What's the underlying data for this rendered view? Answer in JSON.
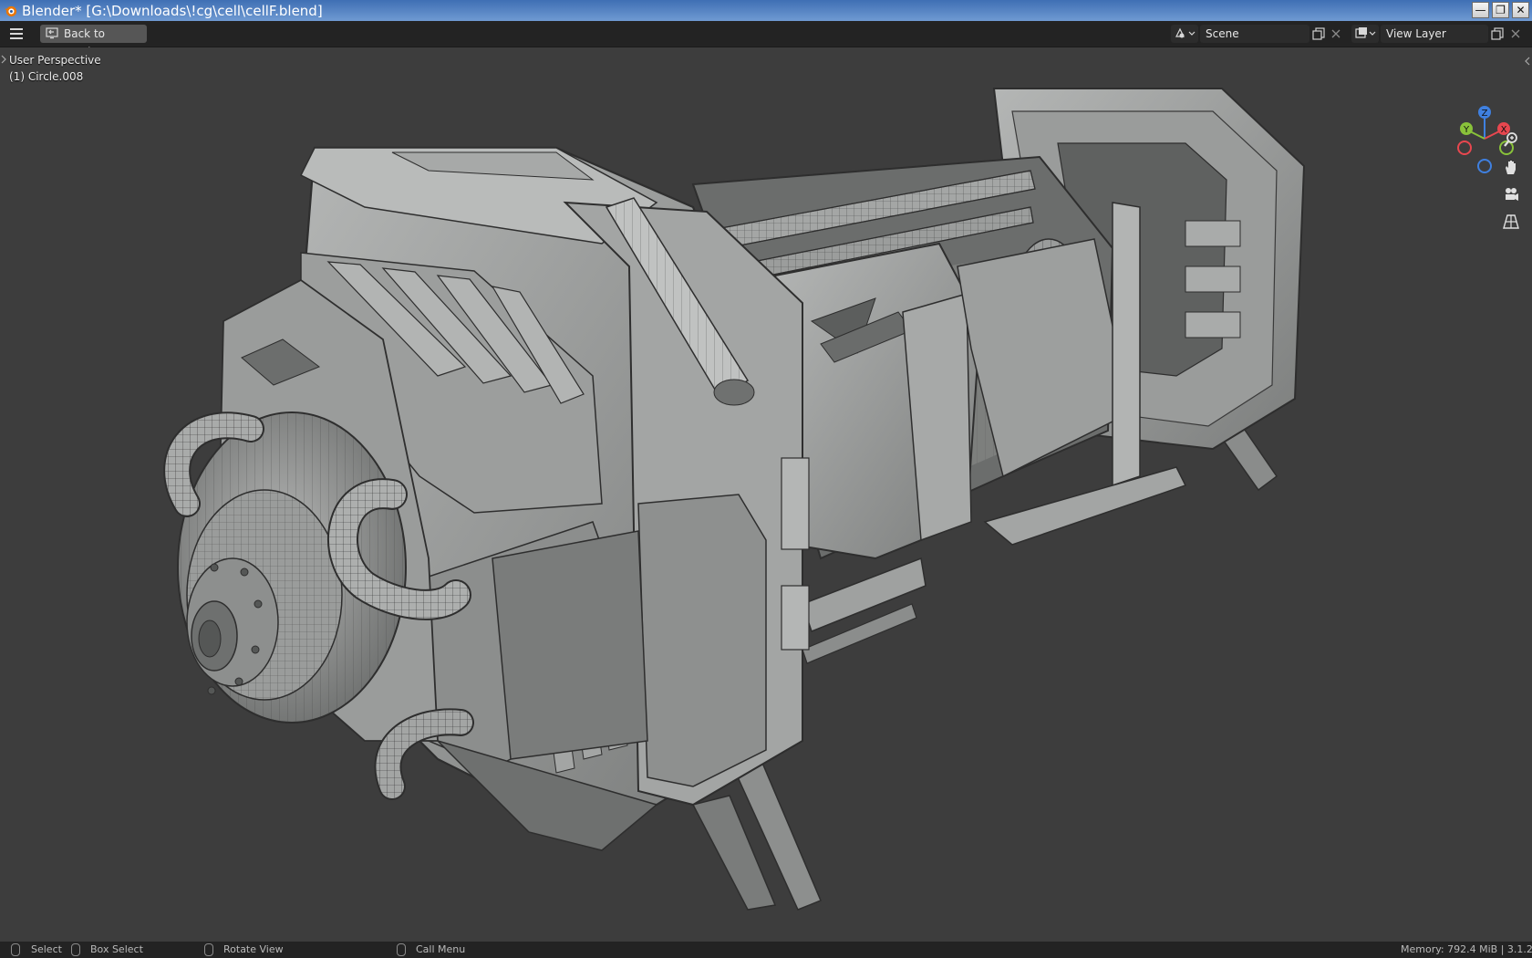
{
  "window": {
    "title": "Blender* [G:\\Downloads\\!cg\\cell\\cellF.blend]",
    "icon": "blender-logo-icon",
    "controls": [
      "minimize-icon",
      "restore-icon",
      "close-icon"
    ]
  },
  "topbar": {
    "menu_icon": "hamburger-menu-icon",
    "back_label": "Back to Previous",
    "scene": {
      "label": "Scene",
      "icon": "scene-icon"
    },
    "view_layer": {
      "label": "View Layer",
      "icon": "view-layer-icon"
    }
  },
  "viewport": {
    "view_name": "User Perspective",
    "object_info": "(1) Circle.008",
    "gizmo_axes": {
      "z": "Z",
      "y": "Y",
      "x": "X"
    },
    "colors": {
      "background": "#3d3d3d",
      "x_axis": "#e8474f",
      "y_axis": "#89c23a",
      "z_axis": "#3f80e0"
    },
    "nav_icons": [
      "zoom-icon",
      "pan-hand-icon",
      "camera-icon",
      "grid-icon"
    ]
  },
  "statusbar": {
    "select": "Select",
    "box_select": "Box Select",
    "rotate_view": "Rotate View",
    "call_menu": "Call Menu",
    "memory": "Memory: 792.4 MiB | 3.1.2"
  }
}
